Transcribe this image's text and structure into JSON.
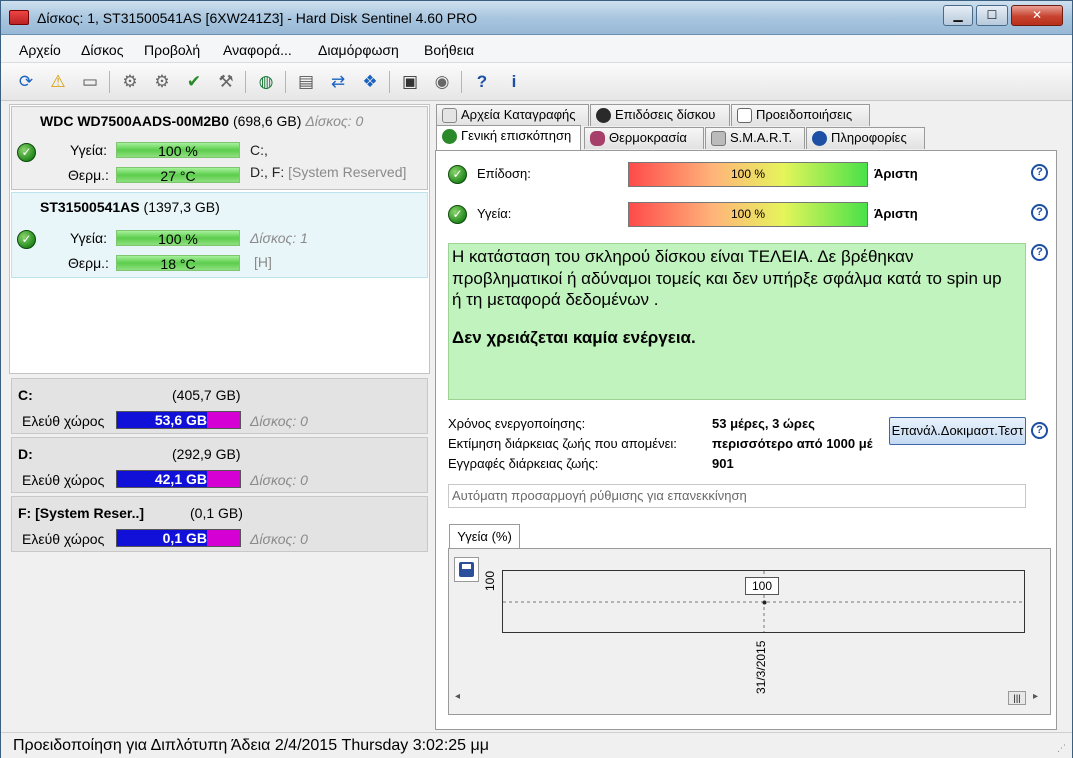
{
  "window": {
    "title": "Δίσκος: 1, ST31500541AS [6XW241Z3]  -  Hard Disk Sentinel 4.60 PRO"
  },
  "menu": [
    "Αρχείο",
    "Δίσκος",
    "Προβολή",
    "Αναφορά...",
    "Διαμόρφωση",
    "Βοήθεια"
  ],
  "toolbar_icons": [
    "refresh-icon",
    "warning-icon",
    "disk-icon",
    "disk-tool-icon",
    "disk-tool-icon-2",
    "disk-check-icon",
    "disk-tool-icon-3",
    "globe-icon",
    "document-icon",
    "refresh-arrows-icon",
    "network-icon",
    "monitor-icon",
    "speaker-icon",
    "help-icon",
    "info-icon"
  ],
  "disks": [
    {
      "name": "WDC WD7500AADS-00M2B0",
      "size": "(698,6 GB)",
      "disk_label": "Δίσκος: 0",
      "health_label": "Υγεία:",
      "health": "100 %",
      "temp_label": "Θερμ.:",
      "temp": "27 °C",
      "drives_1": "C:,",
      "drives_2": "D:, F:",
      "drives_2b": "[System Reserved]"
    },
    {
      "name": "ST31500541AS",
      "size": "(1397,3 GB)",
      "health_label": "Υγεία:",
      "health": "100 %",
      "temp_label": "Θερμ.:",
      "temp": "18 °C",
      "disk_label": "Δίσκος: 1",
      "drives": "[H]"
    }
  ],
  "partitions": [
    {
      "letter": "C:",
      "size": "(405,7 GB)",
      "free_label": "Ελεύθ χώρος",
      "free": "53,6 GB",
      "free_fraction": 0.13,
      "disk": "Δίσκος: 0"
    },
    {
      "letter": "D:",
      "size": "(292,9 GB)",
      "free_label": "Ελεύθ χώρος",
      "free": "42,1 GB",
      "free_fraction": 0.14,
      "disk": "Δίσκος: 0"
    },
    {
      "letter": "F: [System Reser..]",
      "size": "(0,1 GB)",
      "free_label": "Ελεύθ χώρος",
      "free": "0,1 GB",
      "free_fraction": 0.38,
      "disk": "Δίσκος: 0"
    }
  ],
  "tabs_row1": [
    "Αρχεία Καταγραφής",
    "Επιδόσεις δίσκου",
    "Προειδοποιήσεις"
  ],
  "tabs_row2": [
    "Γενική επισκόπηση",
    "Θερμοκρασία",
    "S.M.A.R.T.",
    "Πληροφορίες"
  ],
  "overview": {
    "performance_label": "Επίδοση:",
    "performance": "100 %",
    "performance_rating": "Άριστη",
    "health_label": "Υγεία:",
    "health": "100 %",
    "health_rating": "Άριστη",
    "message": "Η κατάσταση του σκληρού δίσκου είναι ΤΕΛΕΙΑ. Δε βρέθηκαν προβληματικοί ή αδύναμοι τομείς και δεν υπήρξε σφάλμα κατά το spin up ή τη μεταφορά δεδομένων .",
    "message_bold": "Δεν χρειάζεται καμία ενέργεια.",
    "power_on_label": "Χρόνος ενεργοποίησης:",
    "power_on": "53 μέρες, 3 ώρες",
    "lifetime_label": "Εκτίμηση διάρκειας ζωής που απομένει:",
    "lifetime": "περισσότερο από 1000 μέ",
    "lifetime_writes_label": "Εγγραφές διάρκειας ζωής:",
    "lifetime_writes": "901",
    "retest_button": "Επανάλ.Δοκιμαστ.Τεστ",
    "auto_field": "Αυτόματη προσαρμογή ρύθμισης για επανεκκίνηση",
    "chart_tab": "Υγεία (%)"
  },
  "chart_data": {
    "type": "line",
    "x": [
      "31/3/2015"
    ],
    "series": [
      {
        "values": [
          100
        ]
      }
    ],
    "data_labels": [
      "100"
    ],
    "ylabel": "100",
    "grid": true
  },
  "status": "Προειδοποίηση για Διπλότυπη  Άδεια 2/4/2015 Thursday 3:02:25 μμ",
  "colors": {
    "health_green": "#5ccd4c",
    "free_blue": "#1010d8",
    "free_magenta": "#d400d4",
    "message_green": "#c1f3be"
  }
}
